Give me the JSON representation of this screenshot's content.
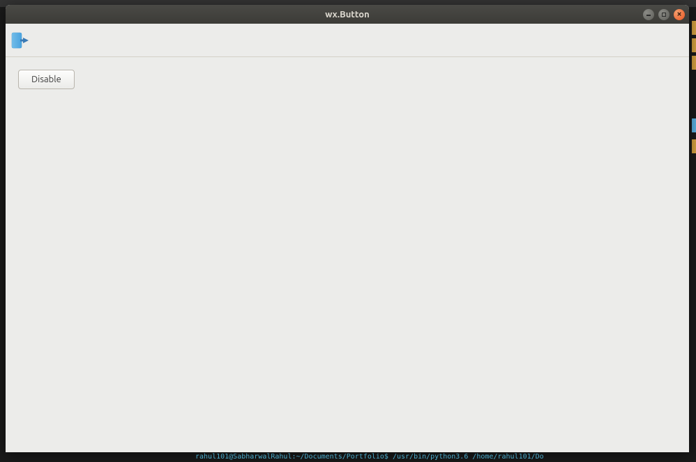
{
  "window": {
    "title": "wx.Button"
  },
  "toolbar": {
    "exit_icon": "exit-icon"
  },
  "content": {
    "disable_button_label": "Disable"
  },
  "background": {
    "terminal_text": "rahul101@SabharwalRahul:~/Documents/Portfolio$ /usr/bin/python3.6 /home/rahul101/Do"
  }
}
